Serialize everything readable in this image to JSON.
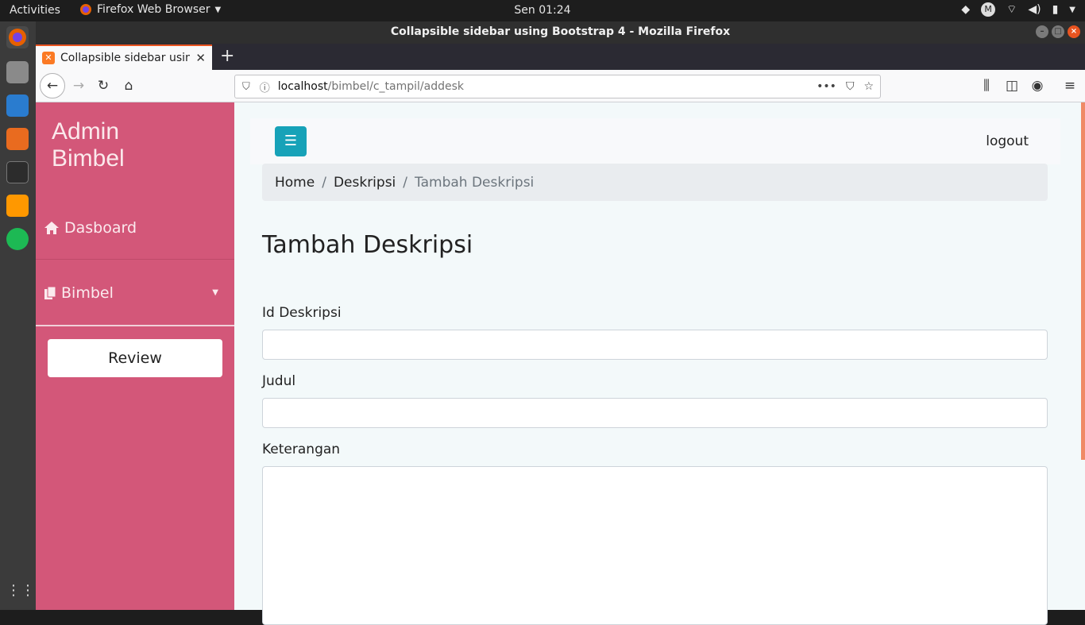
{
  "system": {
    "activities": "Activities",
    "app_name": "Firefox Web Browser",
    "clock": "Sen 01:24"
  },
  "window": {
    "title": "Collapsible sidebar using Bootstrap 4 - Mozilla Firefox"
  },
  "tab": {
    "title": "Collapsible sidebar using Bootstrap 4",
    "favicon": "xampp-icon"
  },
  "url": {
    "host": "localhost",
    "path": "/bimbel/c_tampil/addesk"
  },
  "sidebar": {
    "brand_line1": "Admin",
    "brand_line2": "Bimbel",
    "items": [
      {
        "label": "Dasboard",
        "icon": "home-icon"
      },
      {
        "label": "Bimbel",
        "icon": "copy-icon"
      }
    ],
    "review": "Review"
  },
  "topnav": {
    "logout": "logout"
  },
  "breadcrumb": {
    "home": "Home",
    "section": "Deskripsi",
    "current": "Tambah Deskripsi"
  },
  "page": {
    "title": "Tambah Deskripsi"
  },
  "form": {
    "fields": [
      {
        "label": "Id Deskripsi",
        "value": ""
      },
      {
        "label": "Judul",
        "value": ""
      },
      {
        "label": "Keterangan",
        "value": ""
      }
    ]
  },
  "colors": {
    "sidebar": "#d35779",
    "toggle": "#17a2b8",
    "accent": "#e95420"
  }
}
